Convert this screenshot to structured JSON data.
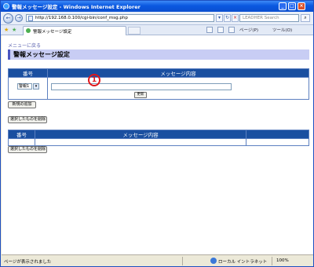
{
  "window": {
    "title": "警報メッセージ設定 - Windows Internet Explorer",
    "minimize": "_",
    "maximize": "□",
    "close": "×"
  },
  "address_bar": {
    "url": "http://192.168.0.100/cgi-bin/conf_msg.php",
    "search_placeholder": "LEADHER Search",
    "back_glyph": "←",
    "forward_glyph": "→"
  },
  "tab": {
    "label": "警報メッセージ設定"
  },
  "commands": {
    "page": "ページ(P)",
    "tools": "ツール(O)"
  },
  "page": {
    "menu_link": "メニューに戻る",
    "title": "警報メッセージ設定",
    "table1": {
      "col_number": "番号",
      "col_message": "メッセージ内容",
      "select_value": "警報1",
      "message_value": "",
      "update_button": "更新"
    },
    "marker": "1",
    "add_button": "新規の追加",
    "delete_button_1": "選択したものを削除",
    "table2": {
      "col_number": "番号",
      "col_message": "メッセージ内容",
      "col_extra": ""
    },
    "delete_button_2": "選択したものを削除"
  },
  "status_bar": {
    "text": "ページが表示されました",
    "zone": "ローカル イントラネット",
    "zoom": "100%"
  },
  "colors": {
    "header_bg": "#1a4fa0",
    "title_band": "#c8cdf4",
    "marker": "#e0161a"
  }
}
